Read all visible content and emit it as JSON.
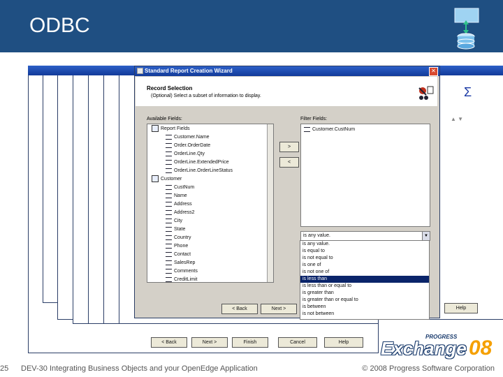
{
  "slide": {
    "title": "ODBC",
    "page_number": "25",
    "footer_left": "DEV-30 Integrating Business Objects and your OpenEdge Application",
    "footer_right": "© 2008 Progress Software Corporation",
    "exchange_brand": "Exchange",
    "exchange_year": "08",
    "progress_brand": "PROGRESS"
  },
  "wizard": {
    "title": "Standard Report Creation Wizard",
    "section_title": "Record Selection",
    "section_desc": "(Optional) Select a subset of information to display.",
    "available_label": "Available Fields:",
    "filter_label": "Filter Fields:",
    "tree": [
      {
        "label": "Report Fields",
        "level": 1,
        "kind": "group"
      },
      {
        "label": "Customer.Name",
        "level": 2,
        "kind": "field"
      },
      {
        "label": "Order.OrderDate",
        "level": 2,
        "kind": "field"
      },
      {
        "label": "OrderLine.Qty",
        "level": 2,
        "kind": "field"
      },
      {
        "label": "OrderLine.ExtendedPrice",
        "level": 2,
        "kind": "field"
      },
      {
        "label": "OrderLine.OrderLineStatus",
        "level": 2,
        "kind": "field"
      },
      {
        "label": "Customer",
        "level": 1,
        "kind": "table"
      },
      {
        "label": "CustNum",
        "level": 2,
        "kind": "field"
      },
      {
        "label": "Name",
        "level": 2,
        "kind": "field"
      },
      {
        "label": "Address",
        "level": 2,
        "kind": "field"
      },
      {
        "label": "Address2",
        "level": 2,
        "kind": "field"
      },
      {
        "label": "City",
        "level": 2,
        "kind": "field"
      },
      {
        "label": "State",
        "level": 2,
        "kind": "field"
      },
      {
        "label": "Country",
        "level": 2,
        "kind": "field"
      },
      {
        "label": "Phone",
        "level": 2,
        "kind": "field"
      },
      {
        "label": "Contact",
        "level": 2,
        "kind": "field"
      },
      {
        "label": "SalesRep",
        "level": 2,
        "kind": "field"
      },
      {
        "label": "Comments",
        "level": 2,
        "kind": "field"
      },
      {
        "label": "CreditLimit",
        "level": 2,
        "kind": "field"
      }
    ],
    "filter_fields": [
      "Customer.CustNum"
    ],
    "add_button": ">",
    "remove_button": "<",
    "operator_selected": "is any value.",
    "operators": [
      "is any value.",
      "is equal to",
      "is not equal to",
      "is one of",
      "is not one of",
      "is less than",
      "is less than or equal to",
      "is greater than",
      "is greater than or equal to",
      "is between",
      "is not between"
    ],
    "operator_highlight_index": 5,
    "buttons": {
      "back": "< Back",
      "next": "Next >",
      "finish": "Finish",
      "cancel": "Cancel",
      "help": "Help"
    },
    "behind_help": "Help"
  },
  "colors": {
    "header": "#1f4f82",
    "titlebar": "#123a99",
    "highlight": "#0a246a"
  }
}
